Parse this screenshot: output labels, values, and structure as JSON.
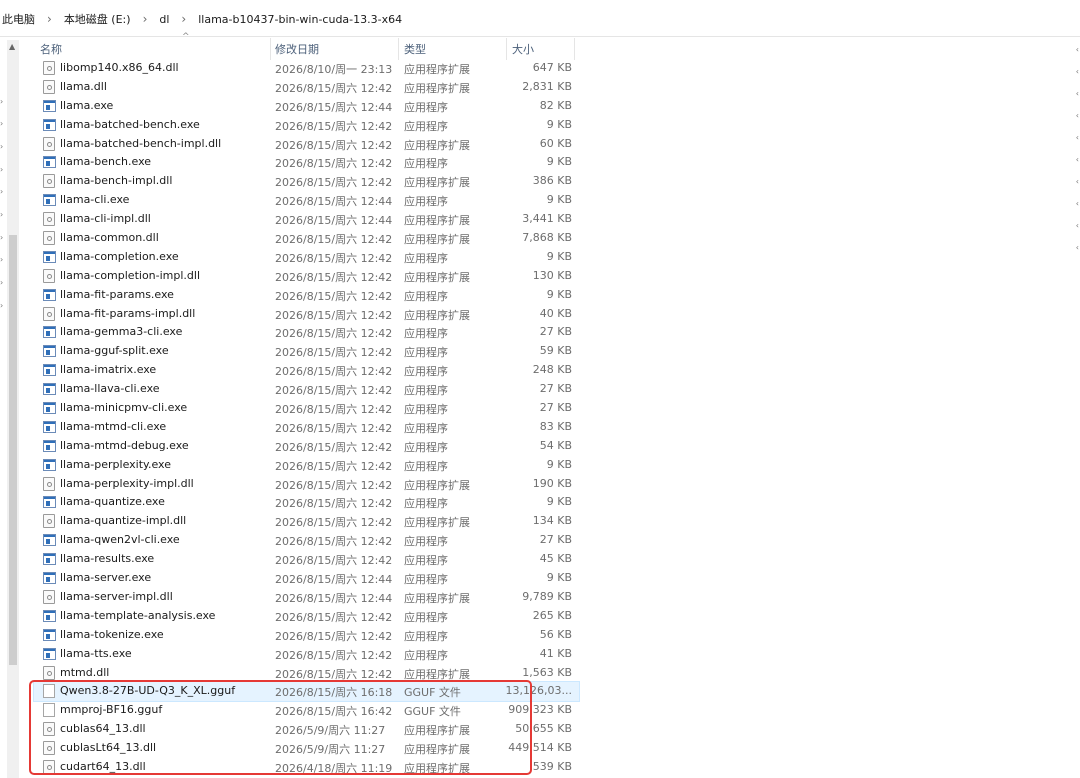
{
  "breadcrumb": {
    "items": [
      "此电脑",
      "本地磁盘 (E:)",
      "dl",
      "llama-b10437-bin-win-cuda-13.3-x64"
    ]
  },
  "columns": {
    "name": "名称",
    "date": "修改日期",
    "type": "类型",
    "size": "大小"
  },
  "files": [
    {
      "name": "libomp140.x86_64.dll",
      "date": "2026/8/10/周一 23:13",
      "type": "应用程序扩展",
      "size": "647 KB",
      "icon": "dll-file-icon"
    },
    {
      "name": "llama.dll",
      "date": "2026/8/15/周六 12:42",
      "type": "应用程序扩展",
      "size": "2,831 KB",
      "icon": "dll-file-icon"
    },
    {
      "name": "llama.exe",
      "date": "2026/8/15/周六 12:44",
      "type": "应用程序",
      "size": "82 KB",
      "icon": "exe-file-icon"
    },
    {
      "name": "llama-batched-bench.exe",
      "date": "2026/8/15/周六 12:42",
      "type": "应用程序",
      "size": "9 KB",
      "icon": "exe-file-icon"
    },
    {
      "name": "llama-batched-bench-impl.dll",
      "date": "2026/8/15/周六 12:42",
      "type": "应用程序扩展",
      "size": "60 KB",
      "icon": "dll-file-icon"
    },
    {
      "name": "llama-bench.exe",
      "date": "2026/8/15/周六 12:42",
      "type": "应用程序",
      "size": "9 KB",
      "icon": "exe-file-icon"
    },
    {
      "name": "llama-bench-impl.dll",
      "date": "2026/8/15/周六 12:42",
      "type": "应用程序扩展",
      "size": "386 KB",
      "icon": "dll-file-icon"
    },
    {
      "name": "llama-cli.exe",
      "date": "2026/8/15/周六 12:44",
      "type": "应用程序",
      "size": "9 KB",
      "icon": "exe-file-icon"
    },
    {
      "name": "llama-cli-impl.dll",
      "date": "2026/8/15/周六 12:44",
      "type": "应用程序扩展",
      "size": "3,441 KB",
      "icon": "dll-file-icon"
    },
    {
      "name": "llama-common.dll",
      "date": "2026/8/15/周六 12:42",
      "type": "应用程序扩展",
      "size": "7,868 KB",
      "icon": "dll-file-icon"
    },
    {
      "name": "llama-completion.exe",
      "date": "2026/8/15/周六 12:42",
      "type": "应用程序",
      "size": "9 KB",
      "icon": "exe-file-icon"
    },
    {
      "name": "llama-completion-impl.dll",
      "date": "2026/8/15/周六 12:42",
      "type": "应用程序扩展",
      "size": "130 KB",
      "icon": "dll-file-icon"
    },
    {
      "name": "llama-fit-params.exe",
      "date": "2026/8/15/周六 12:42",
      "type": "应用程序",
      "size": "9 KB",
      "icon": "exe-file-icon"
    },
    {
      "name": "llama-fit-params-impl.dll",
      "date": "2026/8/15/周六 12:42",
      "type": "应用程序扩展",
      "size": "40 KB",
      "icon": "dll-file-icon"
    },
    {
      "name": "llama-gemma3-cli.exe",
      "date": "2026/8/15/周六 12:42",
      "type": "应用程序",
      "size": "27 KB",
      "icon": "exe-file-icon"
    },
    {
      "name": "llama-gguf-split.exe",
      "date": "2026/8/15/周六 12:42",
      "type": "应用程序",
      "size": "59 KB",
      "icon": "exe-file-icon"
    },
    {
      "name": "llama-imatrix.exe",
      "date": "2026/8/15/周六 12:42",
      "type": "应用程序",
      "size": "248 KB",
      "icon": "exe-file-icon"
    },
    {
      "name": "llama-llava-cli.exe",
      "date": "2026/8/15/周六 12:42",
      "type": "应用程序",
      "size": "27 KB",
      "icon": "exe-file-icon"
    },
    {
      "name": "llama-minicpmv-cli.exe",
      "date": "2026/8/15/周六 12:42",
      "type": "应用程序",
      "size": "27 KB",
      "icon": "exe-file-icon"
    },
    {
      "name": "llama-mtmd-cli.exe",
      "date": "2026/8/15/周六 12:42",
      "type": "应用程序",
      "size": "83 KB",
      "icon": "exe-file-icon"
    },
    {
      "name": "llama-mtmd-debug.exe",
      "date": "2026/8/15/周六 12:42",
      "type": "应用程序",
      "size": "54 KB",
      "icon": "exe-file-icon"
    },
    {
      "name": "llama-perplexity.exe",
      "date": "2026/8/15/周六 12:42",
      "type": "应用程序",
      "size": "9 KB",
      "icon": "exe-file-icon"
    },
    {
      "name": "llama-perplexity-impl.dll",
      "date": "2026/8/15/周六 12:42",
      "type": "应用程序扩展",
      "size": "190 KB",
      "icon": "dll-file-icon"
    },
    {
      "name": "llama-quantize.exe",
      "date": "2026/8/15/周六 12:42",
      "type": "应用程序",
      "size": "9 KB",
      "icon": "exe-file-icon"
    },
    {
      "name": "llama-quantize-impl.dll",
      "date": "2026/8/15/周六 12:42",
      "type": "应用程序扩展",
      "size": "134 KB",
      "icon": "dll-file-icon"
    },
    {
      "name": "llama-qwen2vl-cli.exe",
      "date": "2026/8/15/周六 12:42",
      "type": "应用程序",
      "size": "27 KB",
      "icon": "exe-file-icon"
    },
    {
      "name": "llama-results.exe",
      "date": "2026/8/15/周六 12:42",
      "type": "应用程序",
      "size": "45 KB",
      "icon": "exe-file-icon"
    },
    {
      "name": "llama-server.exe",
      "date": "2026/8/15/周六 12:44",
      "type": "应用程序",
      "size": "9 KB",
      "icon": "exe-file-icon"
    },
    {
      "name": "llama-server-impl.dll",
      "date": "2026/8/15/周六 12:44",
      "type": "应用程序扩展",
      "size": "9,789 KB",
      "icon": "dll-file-icon"
    },
    {
      "name": "llama-template-analysis.exe",
      "date": "2026/8/15/周六 12:42",
      "type": "应用程序",
      "size": "265 KB",
      "icon": "exe-file-icon"
    },
    {
      "name": "llama-tokenize.exe",
      "date": "2026/8/15/周六 12:42",
      "type": "应用程序",
      "size": "56 KB",
      "icon": "exe-file-icon"
    },
    {
      "name": "llama-tts.exe",
      "date": "2026/8/15/周六 12:42",
      "type": "应用程序",
      "size": "41 KB",
      "icon": "exe-file-icon"
    },
    {
      "name": "mtmd.dll",
      "date": "2026/8/15/周六 12:42",
      "type": "应用程序扩展",
      "size": "1,563 KB",
      "icon": "dll-file-icon"
    },
    {
      "name": "Qwen3.8-27B-UD-Q3_K_XL.gguf",
      "date": "2026/8/15/周六 16:18",
      "type": "GGUF 文件",
      "size": "13,126,03...",
      "icon": "blank-file-icon"
    },
    {
      "name": "mmproj-BF16.gguf",
      "date": "2026/8/15/周六 16:42",
      "type": "GGUF 文件",
      "size": "909,323 KB",
      "icon": "blank-file-icon"
    },
    {
      "name": "cublas64_13.dll",
      "date": "2026/5/9/周六 11:27",
      "type": "应用程序扩展",
      "size": "50,655 KB",
      "icon": "dll-file-icon"
    },
    {
      "name": "cublasLt64_13.dll",
      "date": "2026/5/9/周六 11:27",
      "type": "应用程序扩展",
      "size": "449,514 KB",
      "icon": "dll-file-icon"
    },
    {
      "name": "cudart64_13.dll",
      "date": "2026/4/18/周六 11:19",
      "type": "应用程序扩展",
      "size": "539 KB",
      "icon": "dll-file-icon"
    }
  ],
  "highlight_color": "#e53935",
  "hover_row_index": 33
}
